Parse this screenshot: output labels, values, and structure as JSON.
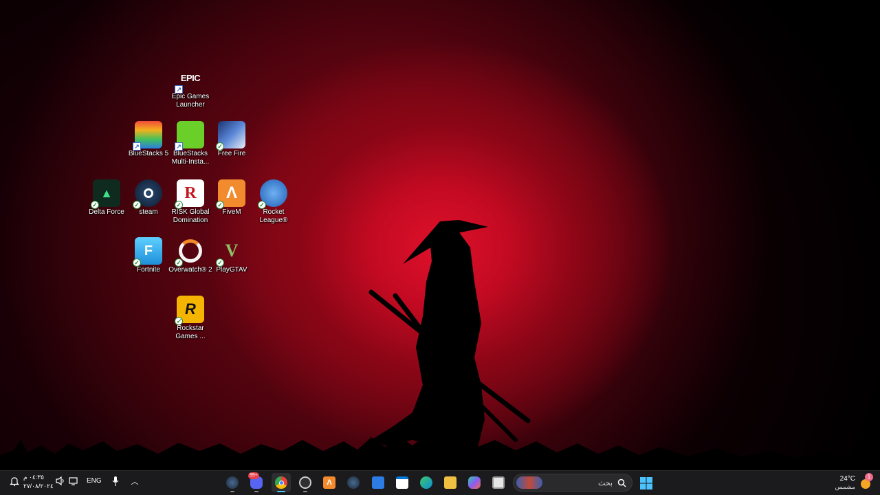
{
  "desktop": {
    "icons": [
      {
        "label": "Epic Games Launcher",
        "icon": "epic-games-icon",
        "color": "#111111",
        "glyph": "EPIC"
      },
      {
        "label": "BlueStacks 5",
        "icon": "bluestacks-icon",
        "color": "#2fa84f",
        "glyph": ""
      },
      {
        "label": "BlueStacks Multi-Insta...",
        "icon": "bluestacks-multi-instance-icon",
        "color": "#6bcf2a",
        "glyph": ""
      },
      {
        "label": "Free Fire",
        "icon": "free-fire-icon",
        "color": "#2b4f9a",
        "glyph": ""
      },
      {
        "label": "Delta Force",
        "icon": "delta-force-icon",
        "color": "#0f2a1f",
        "glyph": "▲"
      },
      {
        "label": "steam",
        "icon": "steam-icon",
        "color": "#16233a",
        "glyph": ""
      },
      {
        "label": "RISK Global Domination",
        "icon": "risk-icon",
        "color": "#ffffff",
        "glyph": "R"
      },
      {
        "label": "FiveM",
        "icon": "fivem-icon",
        "color": "#f28a2e",
        "glyph": "Λ"
      },
      {
        "label": "Rocket League®",
        "icon": "rocket-league-icon",
        "color": "#1f5fb8",
        "glyph": ""
      },
      {
        "label": "Fortnite",
        "icon": "fortnite-icon",
        "color": "#2aa7e8",
        "glyph": "F"
      },
      {
        "label": "Overwatch® 2",
        "icon": "overwatch-icon",
        "color": "#f4f4f4",
        "glyph": ""
      },
      {
        "label": "PlayGTAV",
        "icon": "gta-v-icon",
        "color": "#1a1a1a",
        "glyph": "V"
      },
      {
        "label": "Rockstar Games ...",
        "icon": "rockstar-games-icon",
        "color": "#f5b400",
        "glyph": "R"
      }
    ]
  },
  "taskbar": {
    "search_placeholder": "بحث",
    "apps": [
      {
        "name": "steam",
        "icon": "steam-icon",
        "color": "#1b2838"
      },
      {
        "name": "discord",
        "icon": "discord-icon",
        "color": "#5865f2",
        "badge": "99+"
      },
      {
        "name": "chrome",
        "icon": "chrome-icon",
        "color": "#ea4335"
      },
      {
        "name": "obs",
        "icon": "obs-icon",
        "color": "#302e31"
      },
      {
        "name": "fivem",
        "icon": "fivem-icon",
        "color": "#f28a2e"
      },
      {
        "name": "steam-2",
        "icon": "steam-icon",
        "color": "#2a475e"
      },
      {
        "name": "app",
        "icon": "mail-app-icon",
        "color": "#2d7be5"
      },
      {
        "name": "microsoft-store",
        "icon": "store-icon",
        "color": "#0078d4"
      },
      {
        "name": "edge",
        "icon": "edge-icon",
        "color": "#0c8fd6"
      },
      {
        "name": "file-explorer",
        "icon": "folder-icon",
        "color": "#f0c040"
      },
      {
        "name": "copilot",
        "icon": "copilot-icon",
        "color": "#8a5cf6"
      },
      {
        "name": "task-view",
        "icon": "task-view-icon",
        "color": "#d8d8d8"
      }
    ],
    "tray": {
      "time": "٠٤:٣٥ م",
      "date": "٢٧/٠٨/٢٠٢٤",
      "language": "ENG",
      "weather_temp": "24°C",
      "weather_desc": "مشمس",
      "notification_count": "1"
    }
  }
}
